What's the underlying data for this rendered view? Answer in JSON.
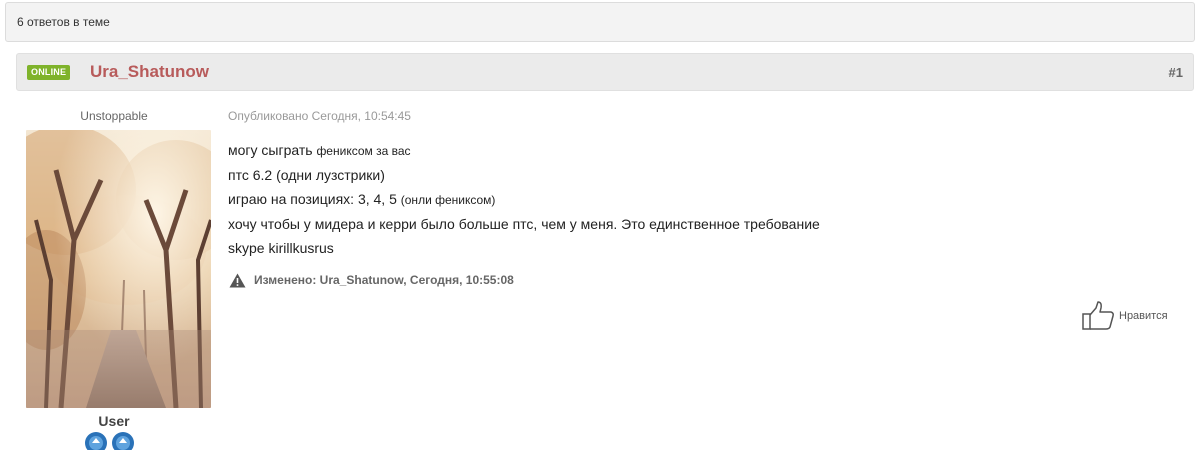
{
  "topic": {
    "replies_count": "6 ответов в теме"
  },
  "post": {
    "status_badge": "ONLINE",
    "author": "Ura_Shatunow",
    "number": "#1",
    "meta": "Опубликовано Сегодня, 10:54:45",
    "lines": {
      "l1_a": "могу сыграть ",
      "l1_b": "фениксом за вас",
      "l2": "птс 6.2 (одни лузстрики)",
      "l3_a": "играю на позициях: 3, 4, 5 ",
      "l3_b": "(онли фениксом)",
      "l4": "хочу чтобы у мидера и керри было больше птс, чем у меня. Это единственное требование",
      "l5": "skype kirillkusrus"
    },
    "edited": "Изменено: Ura_Shatunow, Сегодня, 10:55:08",
    "like_label": "Нравится"
  },
  "user": {
    "title": "Unstoppable",
    "group": "User"
  },
  "colors": {
    "author": "#b85b5b",
    "online": "#7fb32b",
    "rank_icon": "#2a72b8"
  },
  "icons": {
    "edited": "warning-icon",
    "like": "thumbs-up-icon",
    "rank": "rank-badge-icon"
  }
}
